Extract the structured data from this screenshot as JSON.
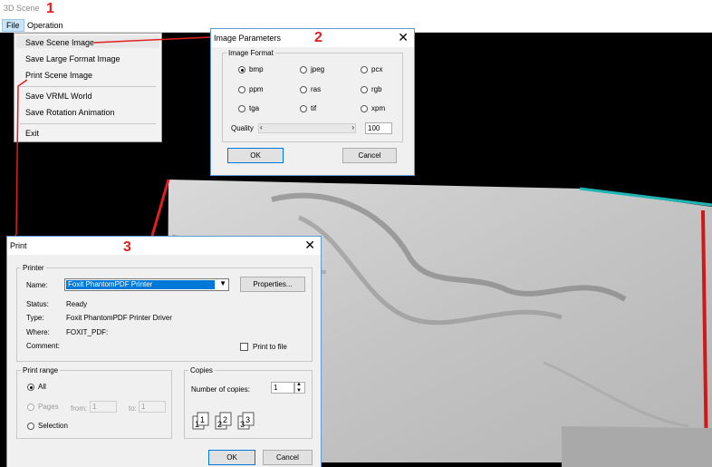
{
  "app": {
    "title": "3D Scene"
  },
  "menubar": {
    "file": "File",
    "operation": "Operation"
  },
  "file_menu": {
    "items": [
      "Save Scene Image",
      "Save Large Format Image",
      "Print Scene Image",
      "Save VRML World",
      "Save Rotation Animation",
      "Exit"
    ]
  },
  "annotations": {
    "one": "1",
    "two": "2",
    "three": "3"
  },
  "image_params": {
    "title": "Image Parameters",
    "group": "Image Format",
    "formats": [
      "bmp",
      "jpeg",
      "pcx",
      "ppm",
      "ras",
      "rgb",
      "tga",
      "tif",
      "xpm"
    ],
    "selected": "bmp",
    "quality_label": "Quality",
    "quality_value": "100",
    "ok": "OK",
    "cancel": "Cancel"
  },
  "print_dialog": {
    "title": "Print",
    "printer_group": "Printer",
    "name_label": "Name:",
    "name_value": "Foxit PhantomPDF Printer",
    "properties": "Properties...",
    "status_label": "Status:",
    "status_value": "Ready",
    "type_label": "Type:",
    "type_value": "Foxit PhantomPDF Printer Driver",
    "where_label": "Where:",
    "where_value": "FOXIT_PDF:",
    "comment_label": "Comment:",
    "print_to_file": "Print to file",
    "range_group": "Print range",
    "all": "All",
    "pages": "Pages",
    "from_label": "from:",
    "from_value": "1",
    "to_label": "to:",
    "to_value": "1",
    "selection": "Selection",
    "copies_group": "Copies",
    "copies_label": "Number of copies:",
    "copies_value": "1",
    "ok": "OK",
    "cancel": "Cancel"
  },
  "colors": {
    "annotation": "#e02020",
    "dialog_border": "#5b9bd5",
    "highlight": "#0078d7"
  }
}
